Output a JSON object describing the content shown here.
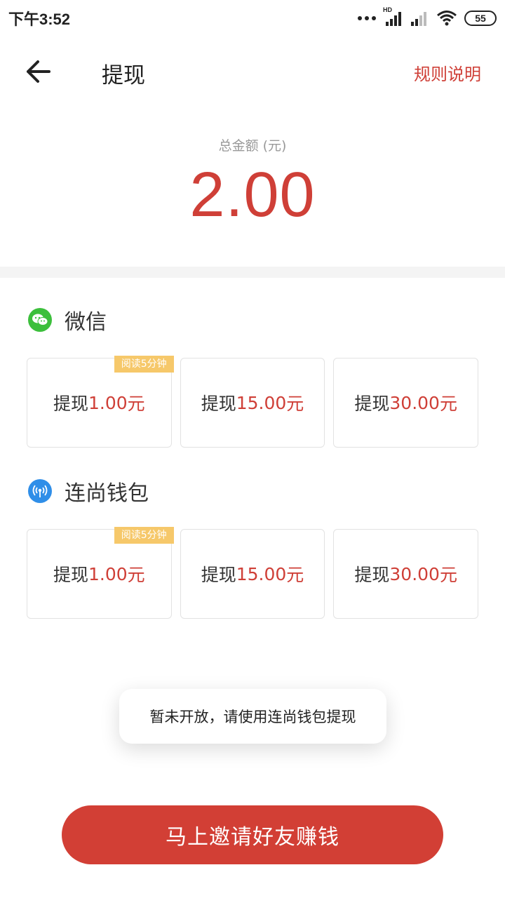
{
  "status_bar": {
    "time": "下午3:52",
    "hd_label": "HD",
    "battery": "55"
  },
  "header": {
    "title": "提现",
    "rules_link": "规则说明",
    "back_icon": "arrow-left-icon"
  },
  "balance": {
    "label": "总金额 (元)",
    "value": "2.00"
  },
  "sections": [
    {
      "title": "微信",
      "icon": "wechat-icon",
      "icon_color": "#3cbf3c",
      "options": [
        {
          "prefix": "提现",
          "amount": "1.00",
          "unit": "元",
          "badge": "阅读5分钟"
        },
        {
          "prefix": "提现",
          "amount": "15.00",
          "unit": "元"
        },
        {
          "prefix": "提现",
          "amount": "30.00",
          "unit": "元"
        }
      ]
    },
    {
      "title": "连尚钱包",
      "icon": "wallet-signal-icon",
      "icon_color": "#2f8ee8",
      "options": [
        {
          "prefix": "提现",
          "amount": "1.00",
          "unit": "元",
          "badge": "阅读5分钟"
        },
        {
          "prefix": "提现",
          "amount": "15.00",
          "unit": "元"
        },
        {
          "prefix": "提现",
          "amount": "30.00",
          "unit": "元"
        }
      ]
    }
  ],
  "toast": "暂未开放，请使用连尚钱包提现",
  "invite_button": "马上邀请好友赚钱",
  "colors": {
    "accent": "#cf3f37",
    "badge": "#f6c86a",
    "button": "#d23f35"
  }
}
